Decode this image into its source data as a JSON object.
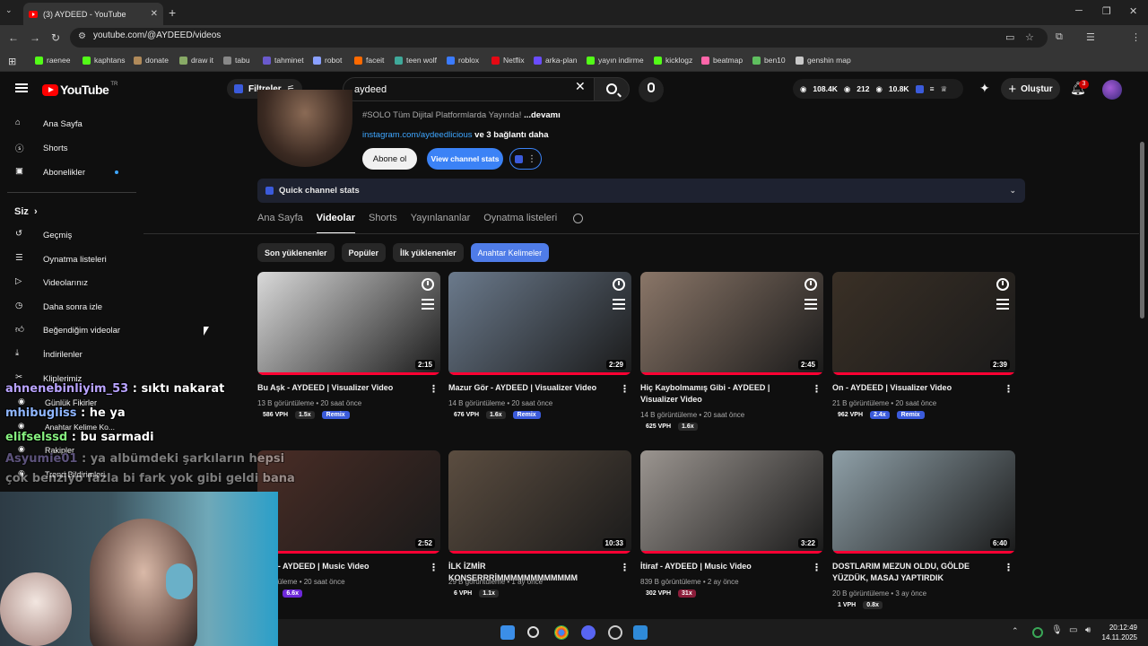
{
  "browser": {
    "tab_title": "(3) AYDEED - YouTube",
    "url": "youtube.com/@AYDEED/videos",
    "bookmarks": [
      "raenee",
      "kaphtans",
      "donate",
      "draw it",
      "tabu",
      "tahminet",
      "robot",
      "faceit",
      "teen wolf",
      "roblox",
      "Netflix",
      "arka-plan",
      "yayın indirme",
      "kicklogz",
      "beatmap",
      "ben10",
      "genshin map"
    ]
  },
  "header": {
    "logo_text": "YouTube",
    "region": "TR",
    "filter_label": "Filtreler",
    "search_value": "aydeed",
    "stats": [
      "108.4K",
      "212",
      "10.8K"
    ],
    "create_label": "Oluştur",
    "notif_count": "3"
  },
  "sidebar": {
    "top": [
      {
        "label": "Ana Sayfa",
        "icon": "home-icon"
      },
      {
        "label": "Shorts",
        "icon": "shorts-icon"
      },
      {
        "label": "Abonelikler",
        "icon": "subscriptions-icon"
      }
    ],
    "section_title": "Siz",
    "you": [
      {
        "label": "Geçmiş",
        "icon": "history-icon"
      },
      {
        "label": "Oynatma listeleri",
        "icon": "playlists-icon"
      },
      {
        "label": "Videolarınız",
        "icon": "your-videos-icon"
      },
      {
        "label": "Daha sonra izle",
        "icon": "watch-later-icon"
      },
      {
        "label": "Beğendiğim videolar",
        "icon": "liked-icon"
      },
      {
        "label": "İndirilenler",
        "icon": "downloads-icon"
      },
      {
        "label": "Kliplerimiz",
        "icon": "clips-icon"
      },
      {
        "label": "Günlük Fikirler",
        "icon": "ideas-icon"
      },
      {
        "label": "Anahtar Kelime Ko...",
        "icon": "keyword-icon"
      },
      {
        "label": "Rakipler",
        "icon": "competitors-icon"
      },
      {
        "label": "Trend Bildirimleri",
        "icon": "trend-icon"
      }
    ]
  },
  "channel": {
    "bio": "#SOLO Tüm Dijital Platformlarda Yayında!",
    "more": "...devamı",
    "link": "instagram.com/aydeedlicious",
    "link_more": "ve 3 bağlantı daha",
    "subscribe": "Abone ol",
    "stats_btn": "View channel stats",
    "quick_stats": "Quick channel stats"
  },
  "tabs": [
    "Ana Sayfa",
    "Videolar",
    "Shorts",
    "Yayınlananlar",
    "Oynatma listeleri"
  ],
  "chips": [
    "Son yüklenenler",
    "Popüler",
    "İlk yüklenenler",
    "Anahtar Kelimeler"
  ],
  "videos": [
    {
      "title": "Bu Aşk - AYDEED | Visualizer Video",
      "duration": "2:15",
      "meta": "13 B görüntüleme • 20 saat önce",
      "vph": "586 VPH",
      "mult": "1.5x",
      "remix": "Remix",
      "thumb": "#d9d9d9"
    },
    {
      "title": "Mazur Gör - AYDEED | Visualizer Video",
      "duration": "2:29",
      "meta": "14 B görüntüleme • 20 saat önce",
      "vph": "676 VPH",
      "mult": "1.6x",
      "remix": "Remix",
      "thumb": "#6b7a8c"
    },
    {
      "title": "Hiç Kaybolmamış Gibi - AYDEED | Visualizer Video",
      "duration": "2:45",
      "meta": "14 B görüntüleme • 20 saat önce",
      "vph": "625 VPH",
      "mult": "1.6x",
      "remix": "",
      "thumb": "#8a7668"
    },
    {
      "title": "On - AYDEED | Visualizer Video",
      "duration": "2:39",
      "meta": "21 B görüntüleme • 20 saat önce",
      "vph": "962 VPH",
      "mult": "2.4x",
      "remix": "Remix",
      "thumb": "#3a3026"
    },
    {
      "title": "Tane - AYDEED | Music Video",
      "duration": "2:52",
      "meta": "görüntüleme • 20 saat önce",
      "vph": "VPH",
      "mult": "6.6x",
      "remix": "",
      "thumb": "#4a2d26"
    },
    {
      "title": "İLK İZMİR KONSERRRİMMMMMMMMMMMM",
      "duration": "10:33",
      "meta": "29 B görüntüleme • 1 ay önce",
      "vph": "6 VPH",
      "mult": "1.1x",
      "remix": "",
      "thumb": "#5b4d40"
    },
    {
      "title": "İtiraf - AYDEED | Music Video",
      "duration": "3:22",
      "meta": "839 B görüntüleme • 2 ay önce",
      "vph": "302 VPH",
      "mult": "31x",
      "remix": "",
      "thumb": "#9b9590"
    },
    {
      "title": "DOSTLARIM MEZUN OLDU, GÖLDE YÜZDÜK, MASAJ YAPTIRDIK",
      "duration": "6:40",
      "meta": "20 B görüntüleme • 3 ay önce",
      "vph": "1 VPH",
      "mult": "0.8x",
      "remix": "",
      "thumb": "#8fa0a8"
    }
  ],
  "chat": [
    {
      "user": "ahnenebinliyim_53",
      "msg": "sıktı nakarat"
    },
    {
      "user": "mhibugliss",
      "msg": "he ya"
    },
    {
      "user": "elifselssd",
      "msg": "bu sarmadi"
    },
    {
      "user": "Asyumie01",
      "msg": "ya albümdeki şarkıların hepsi"
    },
    {
      "user": "",
      "msg": "çok benziyo fazla bi fark yok gibi geldi bana"
    }
  ],
  "taskbar": {
    "time": "20:12:49",
    "date": "14.11.2025"
  }
}
